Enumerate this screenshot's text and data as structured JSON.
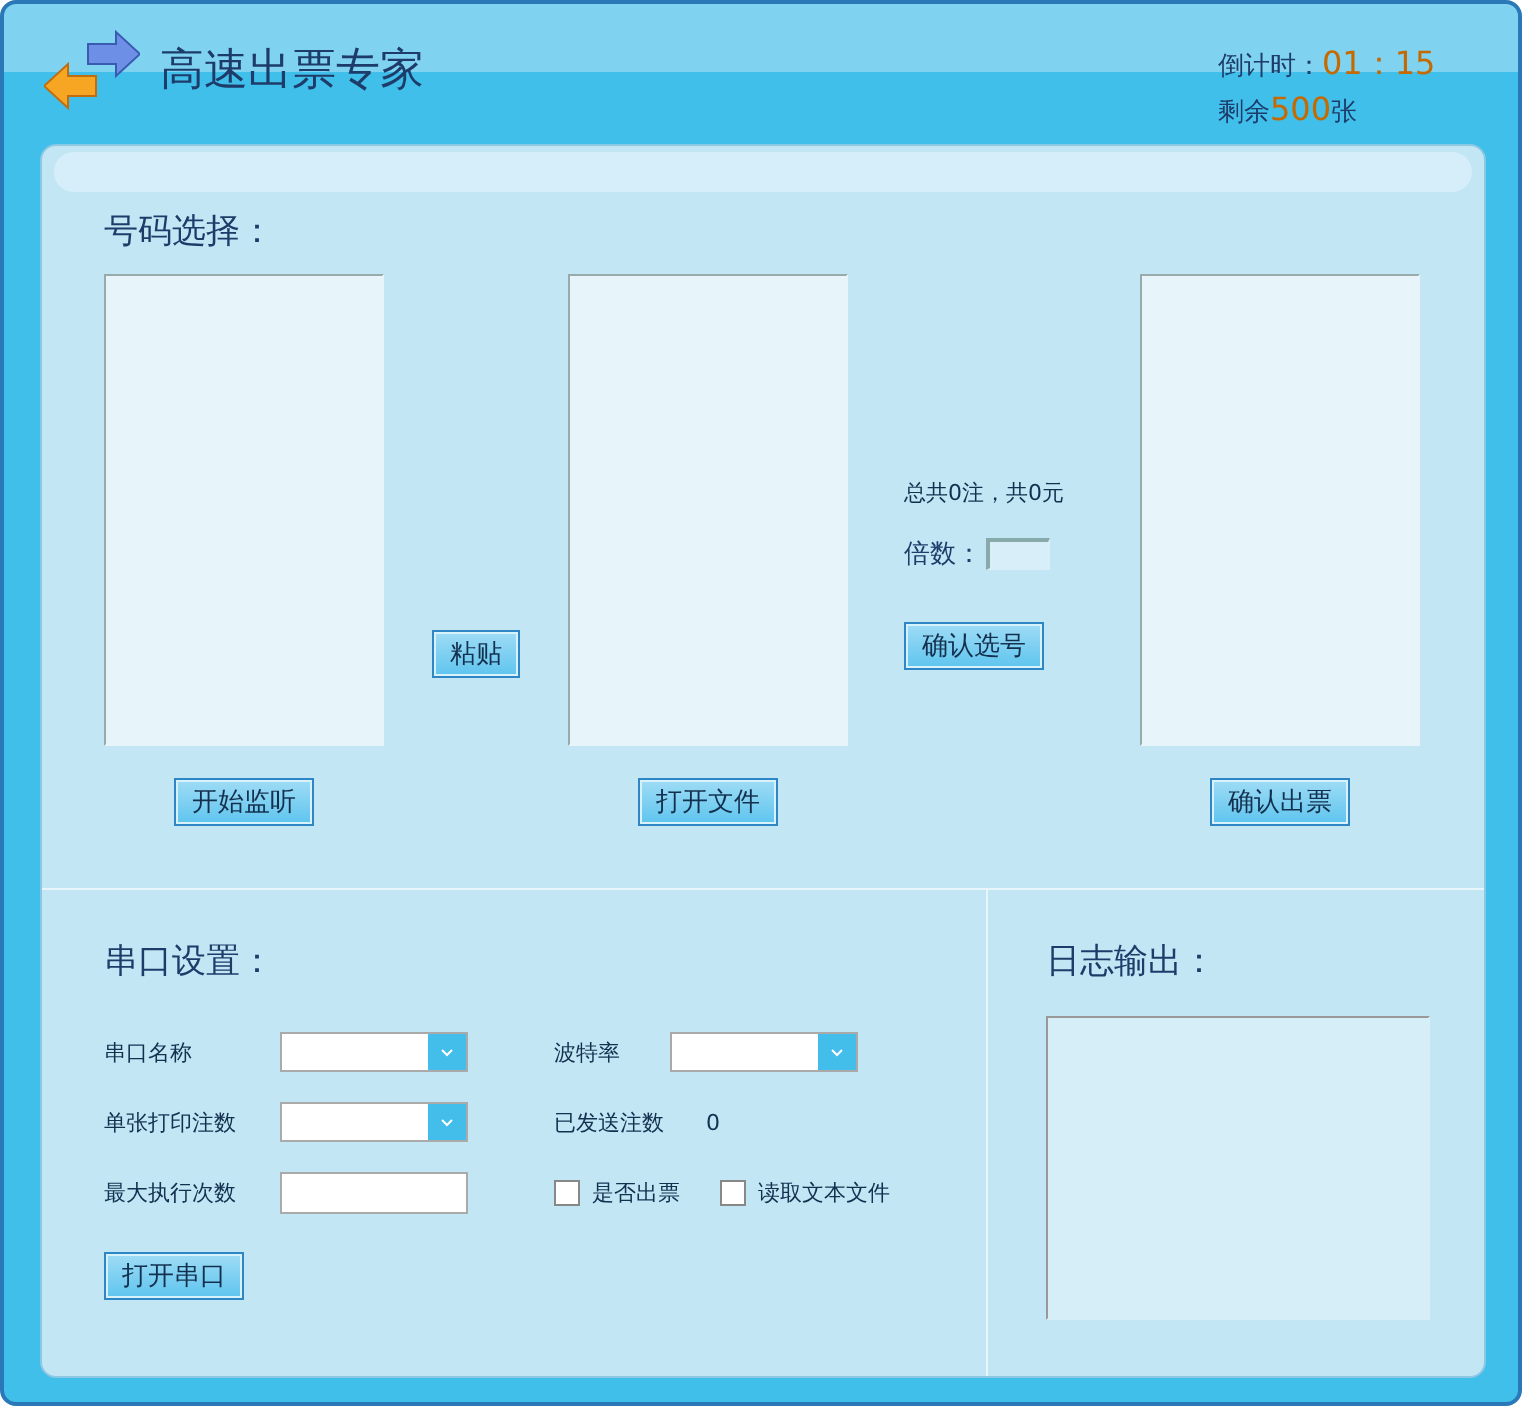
{
  "header": {
    "title": "高速出票专家",
    "countdown_label": "倒计时：",
    "countdown": "01：15",
    "remaining_prefix": "剩余",
    "remaining_count": "500",
    "remaining_suffix": "张"
  },
  "selection": {
    "heading": "号码选择：",
    "start_button": "开始监听",
    "paste_button": "粘贴",
    "open_file_button": "打开文件",
    "total": "总共0注，共0元",
    "multiplier_label": "倍数：",
    "confirm_select_button": "确认选号",
    "confirm_ticket_button": "确认出票"
  },
  "serial": {
    "heading": "串口设置：",
    "left_fields": [
      {
        "label": "串口名称",
        "kind": "dropdown"
      },
      {
        "label": "单张打印注数",
        "kind": "dropdown"
      },
      {
        "label": "最大执行次数",
        "kind": "text"
      }
    ],
    "baud_label": "波特率",
    "sent_label": "已发送注数",
    "sent_value": "0",
    "checkboxes": [
      {
        "label": "是否出票",
        "checked": false
      },
      {
        "label": "读取文本文件",
        "checked": false
      }
    ],
    "open_button": "打开串口"
  },
  "log": {
    "heading": "日志输出："
  }
}
